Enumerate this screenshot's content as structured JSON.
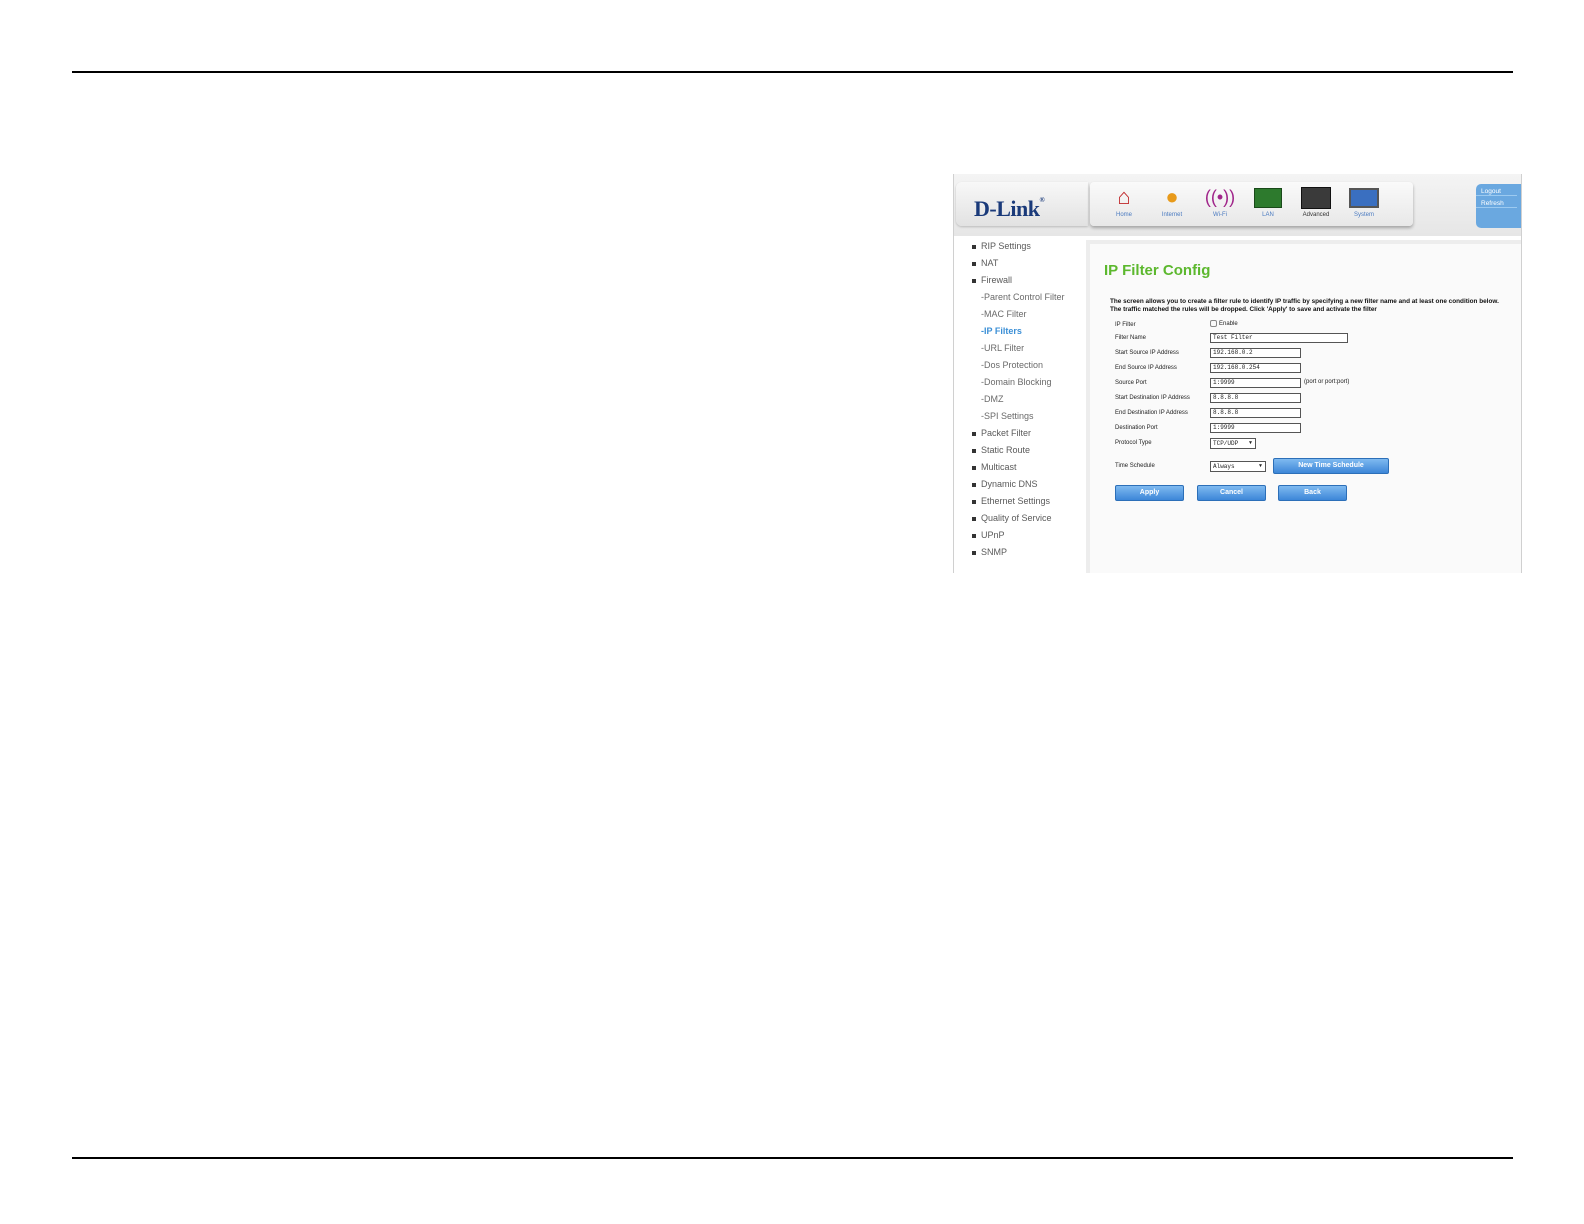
{
  "nav": {
    "logo": "D-Link",
    "logo_mark": "®",
    "items": [
      {
        "label": "Home",
        "icon": "house-icon"
      },
      {
        "label": "Internet",
        "icon": "globe-icon"
      },
      {
        "label": "Wi-Fi",
        "icon": "wifi-icon"
      },
      {
        "label": "LAN",
        "icon": "lan-icon"
      },
      {
        "label": "Advanced",
        "icon": "tools-icon"
      },
      {
        "label": "System",
        "icon": "monitor-icon"
      }
    ],
    "logout": "Logout",
    "refresh": "Refresh"
  },
  "sidebar": {
    "items": [
      "RIP Settings",
      "NAT",
      "Firewall",
      "-Parent Control Filter",
      "-MAC Filter",
      "-IP Filters",
      "-URL Filter",
      "-Dos Protection",
      "-Domain Blocking",
      "-DMZ",
      "-SPI Settings",
      "Packet Filter",
      "Static Route",
      "Multicast",
      "Dynamic DNS",
      "Ethernet Settings",
      "Quality of Service",
      "UPnP",
      "SNMP"
    ]
  },
  "form": {
    "title": "IP Filter Config",
    "description": "The screen allows you to create a filter rule to identify IP traffic by specifying a new filter name and at least one condition below. The traffic matched the rules will be dropped. Click 'Apply' to save and activate the filter",
    "ip_filter_label": "IP Filter",
    "enable_label": "Enable",
    "filter_name_label": "Filter Name",
    "filter_name_value": "Test Filter",
    "start_src_label": "Start Source IP Address",
    "start_src_value": "192.168.0.2",
    "end_src_label": "End Source IP Address",
    "end_src_value": "192.168.0.254",
    "src_port_label": "Source Port",
    "src_port_value": "1:9999",
    "port_hint": "(port or port:port)",
    "start_dst_label": "Start Destination IP Address",
    "start_dst_value": "8.8.8.8",
    "end_dst_label": "End Destination IP Address",
    "end_dst_value": "8.8.8.8",
    "dst_port_label": "Destination Port",
    "dst_port_value": "1:9999",
    "protocol_label": "Protocol Type",
    "protocol_value": "TCP/UDP",
    "schedule_label": "Time Schedule",
    "schedule_value": "Always",
    "new_schedule_btn": "New Time Schedule",
    "apply_btn": "Apply",
    "cancel_btn": "Cancel",
    "back_btn": "Back"
  }
}
